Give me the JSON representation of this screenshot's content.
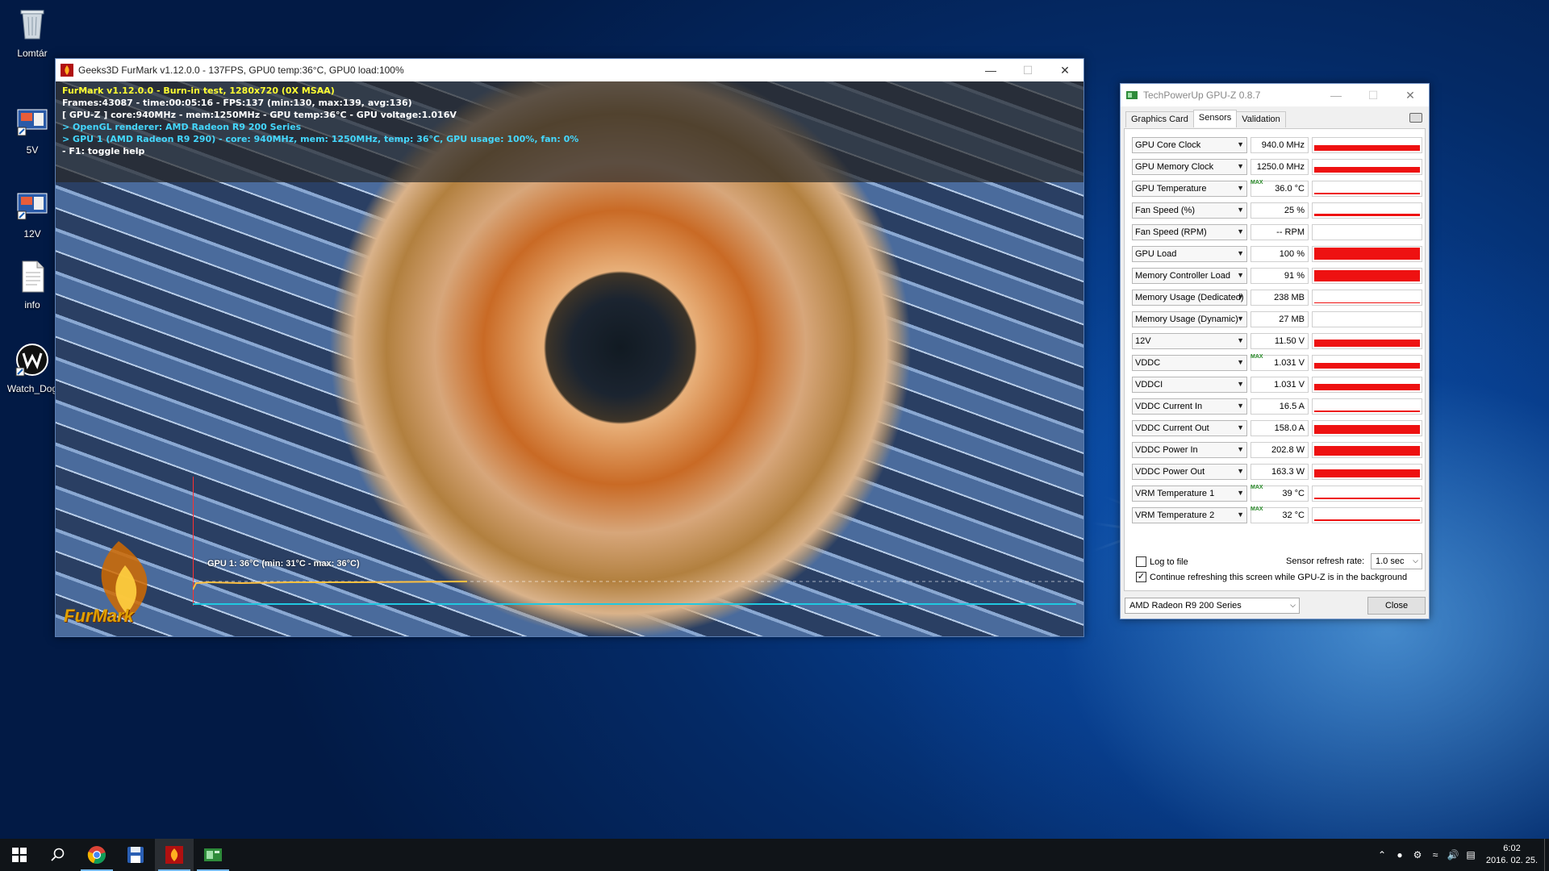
{
  "desktop": {
    "icons": [
      {
        "label": "Lomtár",
        "icon": "recycle-bin-icon"
      },
      {
        "label": "5V",
        "icon": "shortcut-image-icon"
      },
      {
        "label": "12V",
        "icon": "shortcut-image-icon"
      },
      {
        "label": "info",
        "icon": "text-file-icon"
      },
      {
        "label": "Watch_Dog",
        "icon": "watch-dogs-icon"
      }
    ]
  },
  "furmark": {
    "title": "Geeks3D FurMark v1.12.0.0 - 137FPS, GPU0 temp:36°C, GPU0 load:100%",
    "overlay": [
      {
        "text": "FurMark v1.12.0.0 - Burn-in test, 1280x720 (0X MSAA)",
        "color": "yellow"
      },
      {
        "text": "Frames:43087 - time:00:05:16 - FPS:137 (min:130, max:139, avg:136)",
        "color": "white"
      },
      {
        "text": "[ GPU-Z ] core:940MHz - mem:1250MHz - GPU temp:36°C - GPU voltage:1.016V",
        "color": "white"
      },
      {
        "text": "> OpenGL renderer: AMD Radeon R9 200 Series",
        "color": "cyan"
      },
      {
        "text": "> GPU 1 (AMD Radeon R9 290) - core: 940MHz, mem: 1250MHz, temp: 36°C, GPU usage: 100%, fan: 0%",
        "color": "cyan"
      },
      {
        "text": "- F1: toggle help",
        "color": "white"
      }
    ],
    "graph_label": "GPU 1: 36°C (min: 31°C - max: 36°C)",
    "logo_text": "FurMark"
  },
  "gpuz": {
    "title": "TechPowerUp GPU-Z 0.8.7",
    "tabs": [
      {
        "label": "Graphics Card",
        "active": false
      },
      {
        "label": "Sensors",
        "active": true
      },
      {
        "label": "Validation",
        "active": false
      }
    ],
    "max_tag": "MAX",
    "sensors": [
      {
        "label": "GPU Core Clock",
        "value": "940.0 MHz",
        "max": false,
        "level": 0.45
      },
      {
        "label": "GPU Memory Clock",
        "value": "1250.0 MHz",
        "max": false,
        "level": 0.45
      },
      {
        "label": "GPU Temperature",
        "value": "36.0 °C",
        "max": true,
        "level": 0.15
      },
      {
        "label": "Fan Speed (%)",
        "value": "25 %",
        "max": false,
        "level": 0.2
      },
      {
        "label": "Fan Speed (RPM)",
        "value": "-- RPM",
        "max": false,
        "level": 0
      },
      {
        "label": "GPU Load",
        "value": "100 %",
        "max": false,
        "level": 0.95
      },
      {
        "label": "Memory Controller Load",
        "value": "91 %",
        "max": false,
        "level": 0.85
      },
      {
        "label": "Memory Usage (Dedicated)",
        "value": "238 MB",
        "max": false,
        "level": 0.05
      },
      {
        "label": "Memory Usage (Dynamic)",
        "value": "27 MB",
        "max": false,
        "level": 0.02
      },
      {
        "label": "12V",
        "value": "11.50 V",
        "max": false,
        "level": 0.55
      },
      {
        "label": "VDDC",
        "value": "1.031 V",
        "max": true,
        "level": 0.45
      },
      {
        "label": "VDDCI",
        "value": "1.031 V",
        "max": false,
        "level": 0.5
      },
      {
        "label": "VDDC Current In",
        "value": "16.5 A",
        "max": false,
        "level": 0.12
      },
      {
        "label": "VDDC Current Out",
        "value": "158.0 A",
        "max": false,
        "level": 0.7
      },
      {
        "label": "VDDC Power In",
        "value": "202.8 W",
        "max": false,
        "level": 0.75
      },
      {
        "label": "VDDC Power Out",
        "value": "163.3 W",
        "max": false,
        "level": 0.65
      },
      {
        "label": "VRM Temperature 1",
        "value": "39 °C",
        "max": true,
        "level": 0.15
      },
      {
        "label": "VRM Temperature 2",
        "value": "32 °C",
        "max": true,
        "level": 0.15
      }
    ],
    "log_to_file": {
      "label": "Log to file",
      "checked": false
    },
    "refresh_label": "Sensor refresh rate:",
    "refresh_value": "1.0 sec",
    "continue_refresh": {
      "label": "Continue refreshing this screen while GPU-Z is in the background",
      "checked": true
    },
    "gpu_select": "AMD Radeon R9 200 Series",
    "close_label": "Close",
    "graph_color": "#ee1111"
  },
  "taskbar": {
    "apps": [
      {
        "name": "start-button",
        "icon": "windows-logo-icon"
      },
      {
        "name": "search-button",
        "icon": "search-icon"
      },
      {
        "name": "taskbar-chrome",
        "icon": "chrome-icon",
        "running": true
      },
      {
        "name": "taskbar-save-app",
        "icon": "floppy-disk-icon",
        "running": false
      },
      {
        "name": "taskbar-furmark",
        "icon": "furmark-icon",
        "running": true,
        "active": true
      },
      {
        "name": "taskbar-gpuz",
        "icon": "gpuz-icon",
        "running": true
      }
    ],
    "time": "6:02",
    "date": "2016. 02. 25."
  },
  "colors": {
    "accent": "#76b9ed",
    "desktop": "#063a86"
  }
}
